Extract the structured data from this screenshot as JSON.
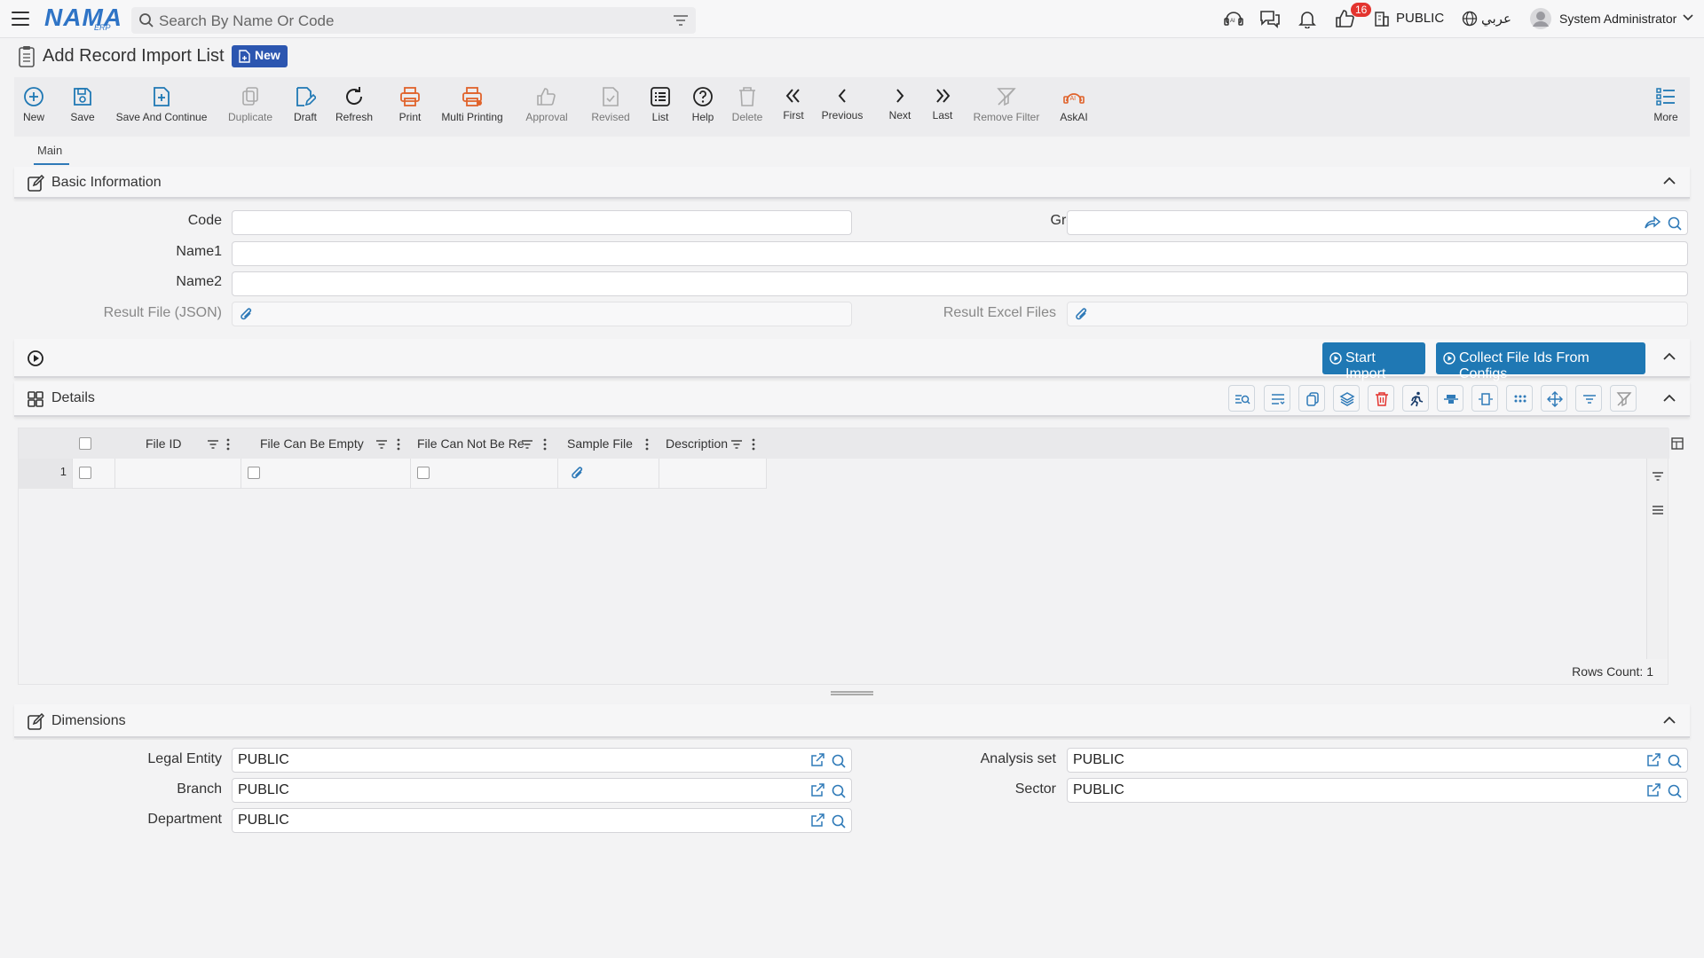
{
  "topbar": {
    "logo": "NAMA",
    "logo_sub": "ERP",
    "search_placeholder": "Search By Name Or Code",
    "notification_count": "16",
    "entity": "PUBLIC",
    "language": "عربي",
    "user": "System Administrator"
  },
  "page": {
    "title": "Add Record Import List",
    "status_badge": "New"
  },
  "toolbar": {
    "new": "New",
    "save": "Save",
    "save_continue": "Save And Continue",
    "duplicate": "Duplicate",
    "draft": "Draft",
    "refresh": "Refresh",
    "print": "Print",
    "multi_printing": "Multi Printing",
    "approval": "Approval",
    "revised": "Revised",
    "list": "List",
    "help": "Help",
    "delete": "Delete",
    "first": "First",
    "previous": "Previous",
    "next": "Next",
    "last": "Last",
    "remove_filter": "Remove Filter",
    "askai": "AskAI",
    "more": "More"
  },
  "tabs": {
    "main": "Main"
  },
  "basic_info": {
    "title": "Basic Information",
    "code_label": "Code",
    "code_value": "",
    "group_label": "Group",
    "group_value": "",
    "name1_label": "Name1",
    "name1_value": "",
    "name2_label": "Name2",
    "name2_value": "",
    "result_file_label": "Result File (JSON)",
    "result_excel_label": "Result Excel Files"
  },
  "actions": {
    "start_import": "Start Import",
    "collect_file_ids": "Collect File Ids From Configs"
  },
  "details": {
    "title": "Details",
    "columns": [
      "File ID",
      "File Can Be Empty",
      "File Can Not Be Re",
      "Sample File",
      "Description"
    ],
    "rows": [
      {
        "index": "1"
      }
    ],
    "rows_count": "Rows Count: 1"
  },
  "dimensions": {
    "title": "Dimensions",
    "legal_entity_label": "Legal Entity",
    "legal_entity_value": "PUBLIC",
    "analysis_set_label": "Analysis set",
    "analysis_set_value": "PUBLIC",
    "branch_label": "Branch",
    "branch_value": "PUBLIC",
    "sector_label": "Sector",
    "sector_value": "PUBLIC",
    "department_label": "Department",
    "department_value": "PUBLIC"
  },
  "colors": {
    "primary_blue": "#1f78b4",
    "logo_blue": "#2f74c6",
    "badge_blue": "#2c56b0",
    "print_orange": "#e0632b",
    "notification_red": "#e3342f"
  }
}
